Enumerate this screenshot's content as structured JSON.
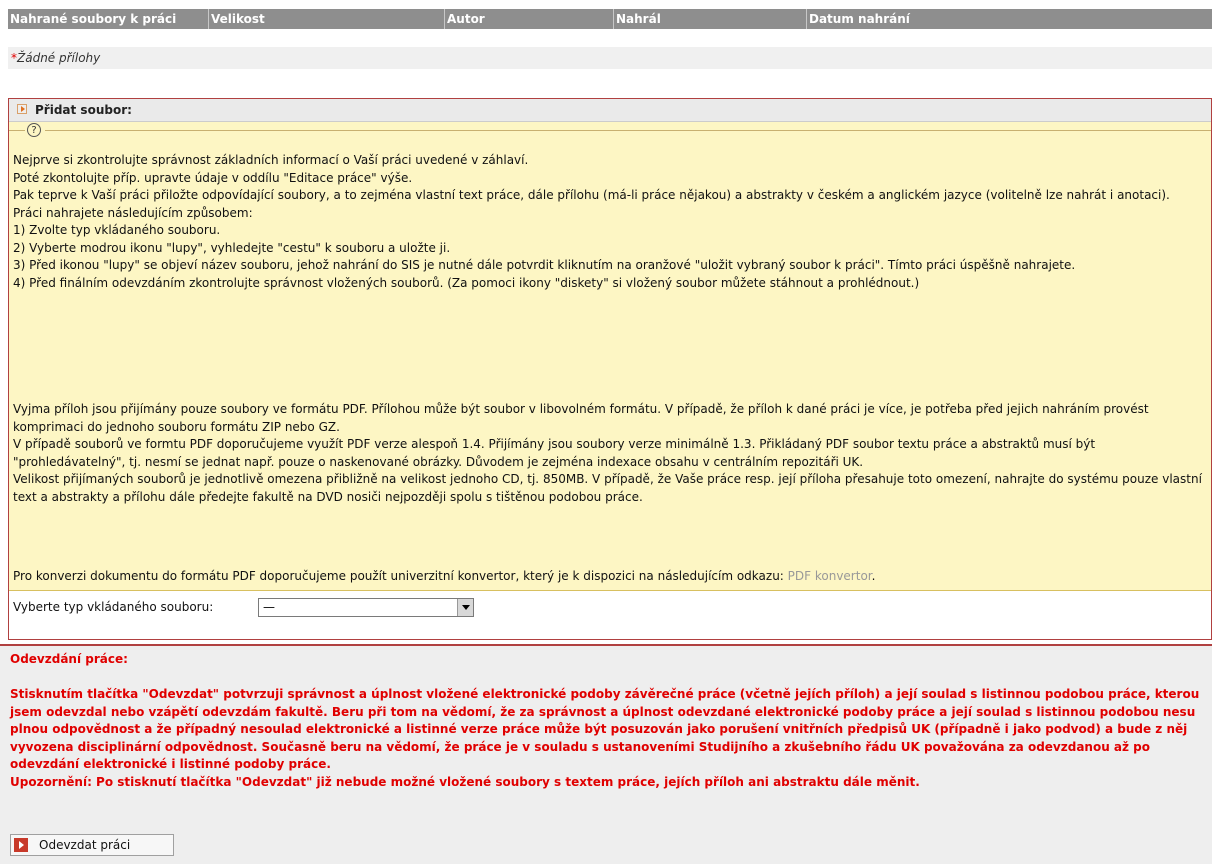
{
  "files_table": {
    "headers": [
      "Nahrané soubory k práci",
      "Velikost",
      "Autor",
      "Nahrál",
      "Datum nahrání"
    ],
    "empty_star": "*",
    "empty_text": "Žádné přílohy"
  },
  "add_file": {
    "title": "Přidat soubor:",
    "help_icon": "?",
    "help_lines": [
      "Nejprve si zkontrolujte správnost základních informací o Vaší práci uvedené v záhlaví.",
      "Poté zkontolujte příp. upravte údaje v oddílu \"Editace práce\" výše.",
      "Pak teprve k Vaší práci přiložte odpovídající soubory, a to zejména vlastní text práce, dále přílohu (má-li práce nějakou) a abstrakty v českém a anglickém jazyce (volitelně lze nahrát i anotaci).",
      "Práci nahrajete následujícím způsobem:",
      "1) Zvolte typ vkládaného souboru.",
      "2) Vyberte modrou ikonu \"lupy\", vyhledejte \"cestu\" k souboru a uložte ji.",
      "3) Před ikonou \"lupy\" se objeví název souboru, jehož nahrání do SIS je nutné dále potvrdit kliknutím na oranžové \"uložit vybraný soubor k práci\". Tímto práci úspěšně nahrajete.",
      "4) Před finálním odevzdáním zkontrolujte správnost vložených souborů. (Za pomoci ikony \"diskety\" si vložený soubor můžete stáhnout a prohlédnout.)"
    ],
    "format_lines": [
      "Vyjma příloh jsou přijímány pouze soubory ve formátu PDF. Přílohou může být soubor v libovolném formátu. V případě, že příloh k dané práci je více, je potřeba před jejich nahráním provést komprimaci do jednoho souboru formátu ZIP nebo GZ.",
      "V případě souborů ve formtu PDF doporučujeme využít PDF verze alespoň 1.4. Přijímány jsou soubory verze minimálně 1.3. Přikládaný PDF soubor textu práce a abstraktů musí být \"prohledávatelný\", tj. nesmí se jednat např. pouze o naskenované obrázky. Důvodem je zejména indexace obsahu v centrálním repozitáři UK.",
      "Velikost přijímaných souborů je jednotlivě omezena přibližně na velikost jednoho CD, tj. 850MB. V případě, že Vaše práce resp. její příloha přesahuje toto omezení, nahrajte do systému pouze vlastní text a abstrakty a přílohu dále předejte fakultě na DVD nosiči nejpozději spolu s tištěnou podobou práce."
    ],
    "converter_text": "Pro konverzi dokumentu do formátu PDF doporučujeme použít univerzitní konvertor, který je k dispozici na následujícím odkazu: ",
    "converter_link": "PDF konvertor",
    "converter_end": ".",
    "type_label": "Vyberte typ vkládaného souboru:",
    "type_value": "—"
  },
  "submission": {
    "title": "Odevzdání práce:",
    "paragraph": "Stisknutím tlačítka \"Odevzdat\" potvrzuji správnost a úplnost vložené elektronické podoby závěrečné práce (včetně jejích příloh) a její soulad s listinnou podobou práce, kterou jsem odevzdal nebo vzápětí odevzdám fakultě. Beru při tom na vědomí, že za správnost a úplnost odevzdané elektronické podoby práce a její soulad s listinnou podobou nesu plnou odpovědnost a že případný nesoulad elektronické a listinné verze práce může být posuzován jako porušení vnitřních předpisů UK (případně i jako podvod) a bude z něj vyvozena disciplinární odpovědnost. Současně beru na vědomí, že práce je v souladu s ustanoveními Studijního a zkušebního řádu UK považována za odevzdanou až po odevzdání elektronické i listinné podoby práce.",
    "warning": "Upozornění: Po stisknutí tlačítka \"Odevzdat\" již nebude možné vložené soubory s textem práce, jejích příloh ani abstraktu dále měnit.",
    "button_label": "Odevzdat práci"
  },
  "colors": {
    "header_bg": "#8e8e8e",
    "help_bg": "#fdf6c4",
    "warning_text": "#e00000",
    "panel_border": "#b04040"
  },
  "icons": [
    "help-icon",
    "expand-triangle-icon",
    "dropdown-arrow-icon",
    "submit-arrow-icon"
  ]
}
